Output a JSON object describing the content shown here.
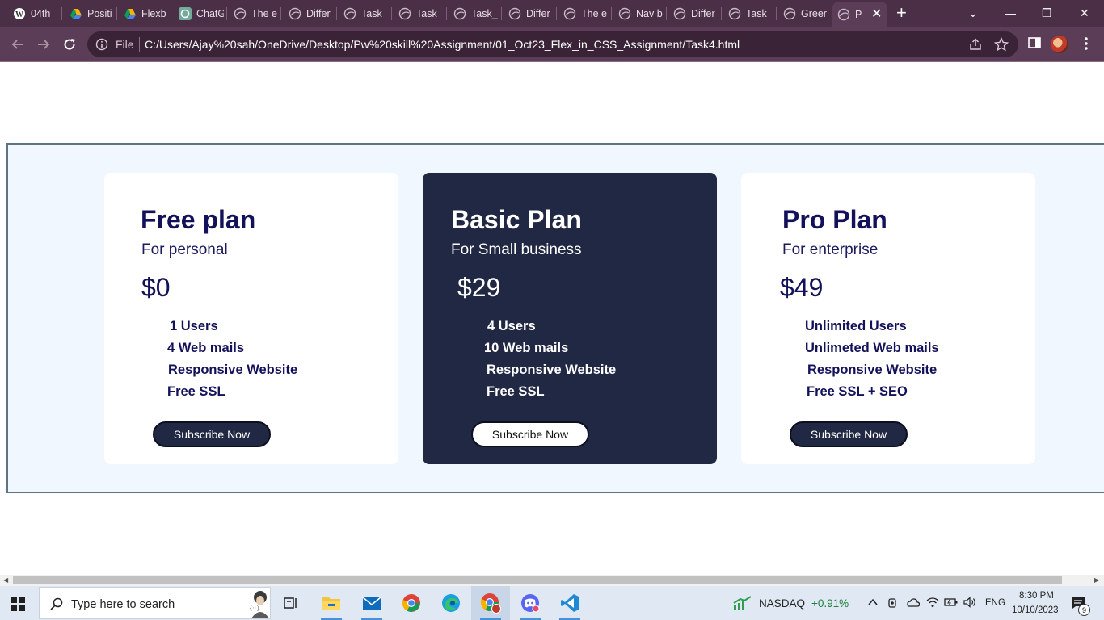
{
  "browser": {
    "tabs": [
      {
        "label": "04th",
        "icon": "wordpress-icon"
      },
      {
        "label": "Positi",
        "icon": "google-drive-icon"
      },
      {
        "label": "Flexb",
        "icon": "google-drive-icon"
      },
      {
        "label": "ChatG",
        "icon": "chatgpt-icon"
      },
      {
        "label": "The e",
        "icon": "globe-icon"
      },
      {
        "label": "Differ",
        "icon": "globe-icon"
      },
      {
        "label": "Task",
        "icon": "globe-icon"
      },
      {
        "label": "Task",
        "icon": "globe-icon"
      },
      {
        "label": "Task_",
        "icon": "globe-icon"
      },
      {
        "label": "Differ",
        "icon": "globe-icon"
      },
      {
        "label": "The e",
        "icon": "globe-icon"
      },
      {
        "label": "Nav b",
        "icon": "globe-icon"
      },
      {
        "label": "Differ",
        "icon": "globe-icon"
      },
      {
        "label": "Task",
        "icon": "globe-icon"
      },
      {
        "label": "Greer",
        "icon": "globe-icon"
      },
      {
        "label": "P",
        "icon": "globe-icon",
        "active": true
      }
    ],
    "close_glyph": "✕",
    "new_tab_glyph": "+",
    "window_controls": {
      "dropdown": "⌄",
      "minimize": "—",
      "restore": "❐",
      "close": "✕"
    },
    "address": {
      "scheme_label": "File",
      "url": "C:/Users/Ajay%20sah/OneDrive/Desktop/Pw%20skill%20Assignment/01_Oct23_Flex_in_CSS_Assignment/Task4.html"
    },
    "theme_color": "#4a2f46"
  },
  "pricing": {
    "plans": [
      {
        "title": "Free plan",
        "subtitle": "For personal",
        "price": "$0",
        "features": [
          "1 Users",
          "4 Web mails",
          "Responsive Website",
          "Free SSL"
        ],
        "button": "Subscribe Now",
        "theme": "light"
      },
      {
        "title": "Basic Plan",
        "subtitle": "For Small business",
        "price": "$29",
        "features": [
          "4 Users",
          "10 Web mails",
          "Responsive Website",
          "Free SSL"
        ],
        "button": "Subscribe Now",
        "theme": "dark"
      },
      {
        "title": "Pro Plan",
        "subtitle": "For enterprise",
        "price": "$49",
        "features": [
          "Unlimited Users",
          "Unlimeted Web mails",
          "Responsive Website",
          "Free SSL + SEO"
        ],
        "button": "Subscribe Now",
        "theme": "light"
      }
    ],
    "colors": {
      "section_bg": "#f0f7ff",
      "dark_card": "#212843",
      "heading": "#12115a"
    }
  },
  "taskbar": {
    "search_placeholder": "Type here to search",
    "apps": [
      "task-view-icon",
      "file-explorer-icon",
      "mail-icon",
      "chrome-icon",
      "edge-icon",
      "chrome-profile-icon",
      "discord-icon",
      "vscode-icon"
    ],
    "widget": {
      "label": "NASDAQ",
      "value": "+0.91%"
    },
    "language": "ENG",
    "time": "8:30 PM",
    "date": "10/10/2023",
    "notification_count": "9"
  }
}
